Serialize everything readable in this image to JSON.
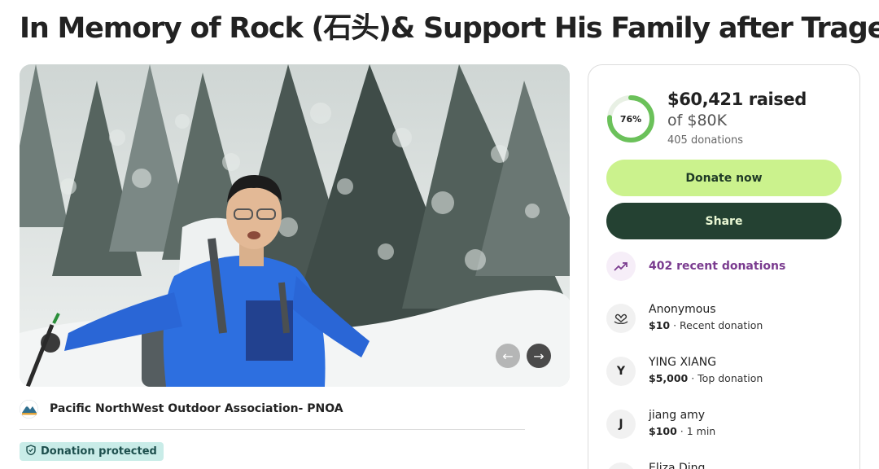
{
  "page": {
    "title": "In Memory of Rock (石头)& Support His Family after Tragedy"
  },
  "gallery": {
    "prev_glyph": "←",
    "next_glyph": "→",
    "image": "hiker-in-blue-jacket-snowy-forest"
  },
  "organizer": {
    "name": "Pacific NorthWest Outdoor Association- PNOA",
    "logo_icon": "pnoa-mountain-logo"
  },
  "badge": {
    "label": "Donation protected",
    "icon": "shield-icon",
    "bg_color": "#c9ece8"
  },
  "progress": {
    "percent": 76,
    "percent_label": "76%",
    "raised": "$60,421 raised",
    "goal": "of $80K",
    "donations_count": "405 donations",
    "ring_color": "#6bc15a"
  },
  "actions": {
    "donate_label": "Donate now",
    "share_label": "Share",
    "donate_color": "#cbf28d",
    "share_color": "#244132"
  },
  "recent": {
    "label": "402 recent donations",
    "icon": "trending-up-icon",
    "color": "#7a3b8f"
  },
  "donations": [
    {
      "avatar": "",
      "avatar_icon": "heart-hand-icon",
      "name": "Anonymous",
      "amount": "$10",
      "detail": " · Recent donation"
    },
    {
      "avatar": "Y",
      "name": "YING XIANG",
      "amount": "$5,000",
      "detail": " · Top donation"
    },
    {
      "avatar": "J",
      "name": "jiang amy",
      "amount": "$100",
      "detail": " · 1 min"
    },
    {
      "avatar": "",
      "name": "Eliza Ding",
      "amount": "",
      "detail": ""
    }
  ]
}
